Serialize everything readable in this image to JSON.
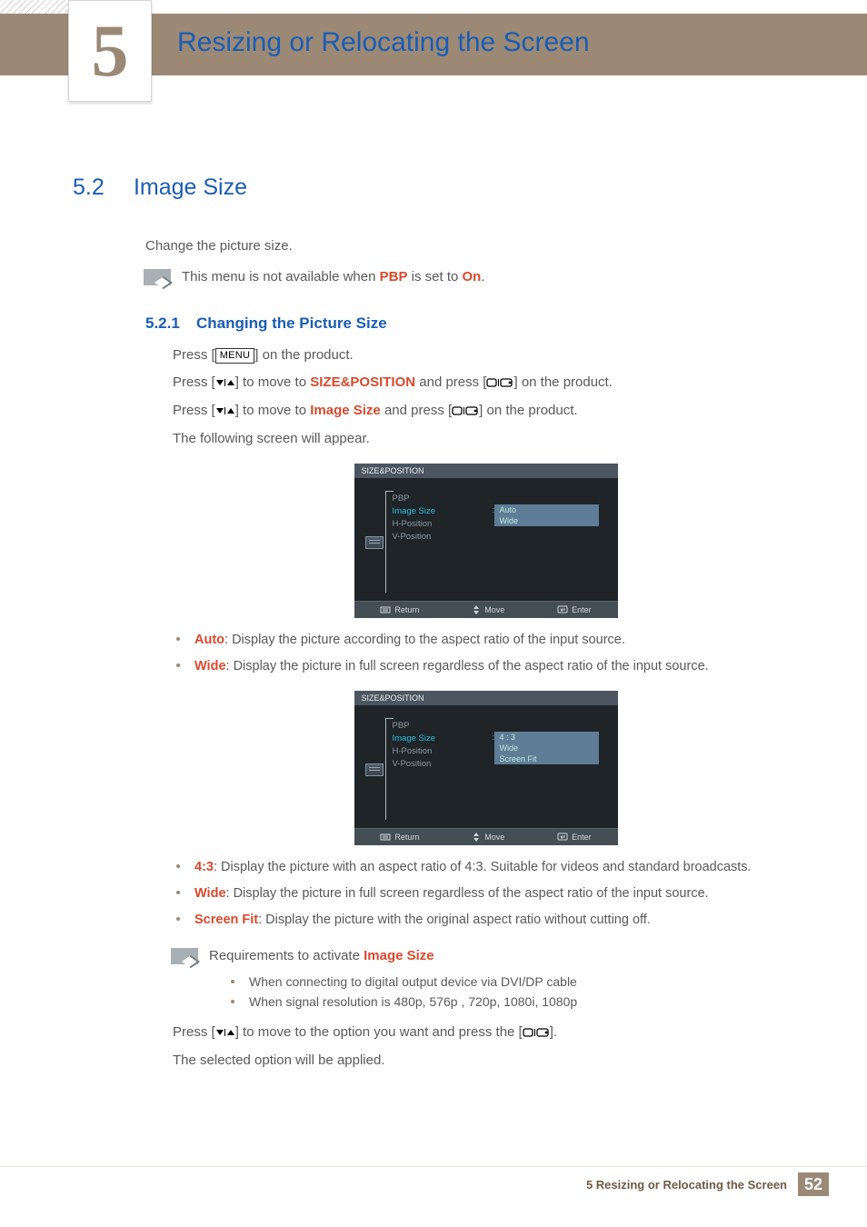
{
  "header": {
    "chapter_number": "5",
    "chapter_title": "Resizing or Relocating the Screen"
  },
  "section": {
    "number": "5.2",
    "title": "Image Size",
    "intro": "Change the picture size.",
    "note_prefix": "This menu is not available when ",
    "note_pbp": "PBP",
    "note_mid": " is set to ",
    "note_on": "On",
    "note_suffix": "."
  },
  "subsection": {
    "number": "5.2.1",
    "title": "Changing the Picture Size"
  },
  "steps": {
    "s1a": "Press [",
    "s1_menu": "MENU",
    "s1b": "] on the product.",
    "s2a": "Press [",
    "s2b": "] to move to ",
    "s2_target": "SIZE&POSITION",
    "s2c": " and press [",
    "s2d": "] on the product.",
    "s3a": "Press [",
    "s3b": "] to move to ",
    "s3_target": "Image Size",
    "s3c": " and press [",
    "s3d": "] on the product.",
    "s4": "The following screen will appear."
  },
  "osd": {
    "title": "SIZE&POSITION",
    "menu_items": [
      "PBP",
      "Image Size",
      "H-Position",
      "V-Position"
    ],
    "options_a": [
      "Auto",
      "Wide"
    ],
    "options_b": [
      "4 : 3",
      "Wide",
      "Screen Fit"
    ],
    "footer": {
      "return": "Return",
      "move": "Move",
      "enter": "Enter"
    }
  },
  "bullets_a": [
    {
      "term": "Auto",
      "desc": ": Display the picture according to the aspect ratio of the input source."
    },
    {
      "term": "Wide",
      "desc": ": Display the picture in full screen regardless of the aspect ratio of the input source."
    }
  ],
  "bullets_b": [
    {
      "term": "4:3",
      "desc": ": Display the picture with an aspect ratio of 4:3. Suitable for videos and standard broadcasts."
    },
    {
      "term": "Wide",
      "desc": ": Display the picture in full screen regardless of the aspect ratio of the input source."
    },
    {
      "term": "Screen Fit",
      "desc": ": Display the picture with the original aspect ratio without cutting off."
    }
  ],
  "req_note": {
    "lead": "Requirements to activate ",
    "term": "Image Size",
    "items": [
      "When connecting to digital output device via DVI/DP cable",
      "When signal resolution is 480p, 576p , 720p, 1080i, 1080p"
    ]
  },
  "closing": {
    "c1a": "Press [",
    "c1b": "] to move to the option you want and press the [",
    "c1c": "].",
    "c2": "The selected option will be applied."
  },
  "footer": {
    "text": "5 Resizing or Relocating the Screen",
    "page": "52"
  }
}
